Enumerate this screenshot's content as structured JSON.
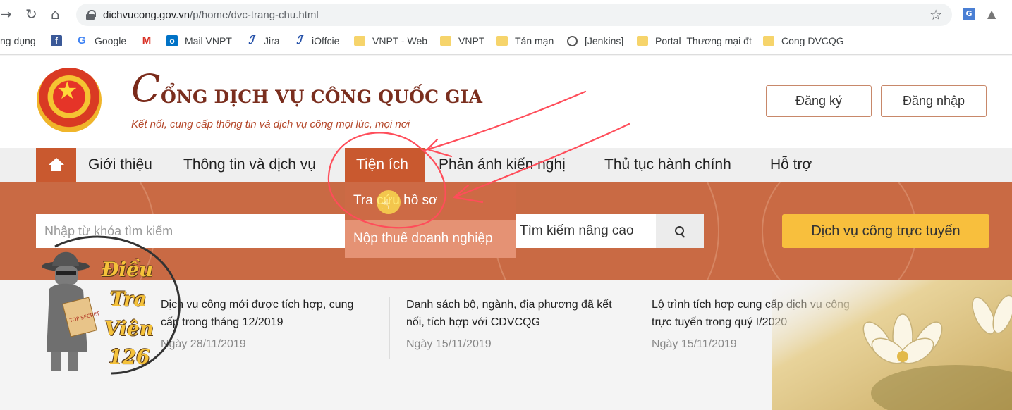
{
  "browser": {
    "url_host": "dichvucong.gov.vn",
    "url_path": "/p/home/dvc-trang-chu.html",
    "bookmarks": [
      {
        "icon": "folder-icon",
        "label": "ng dụng"
      },
      {
        "icon": "facebook-icon",
        "label": ""
      },
      {
        "icon": "google-icon",
        "label": "Google"
      },
      {
        "icon": "gmail-icon",
        "label": ""
      },
      {
        "icon": "outlook-icon",
        "label": "Mail VNPT"
      },
      {
        "icon": "jira-icon",
        "label": "Jira"
      },
      {
        "icon": "ioffice-icon",
        "label": "iOffcie"
      },
      {
        "icon": "folder-icon",
        "label": "VNPT - Web"
      },
      {
        "icon": "folder-icon",
        "label": "VNPT"
      },
      {
        "icon": "folder-icon",
        "label": "Tản mạn"
      },
      {
        "icon": "globe-icon",
        "label": "[Jenkins]"
      },
      {
        "icon": "folder-icon",
        "label": "Portal_Thương mại đt"
      },
      {
        "icon": "folder-icon",
        "label": "Cong DVCQG"
      }
    ]
  },
  "header": {
    "title": "ỔNG DỊCH VỤ CÔNG QUỐC GIA",
    "logo_letter": "C",
    "slogan": "Kết nối, cung cấp thông tin và dịch vụ công mọi lúc, mọi nơi",
    "register_label": "Đăng ký",
    "login_label": "Đăng nhập"
  },
  "nav": {
    "items": [
      "Giới thiệu",
      "Thông tin và dịch vụ",
      "Tiện ích",
      "Phản ánh kiến nghị",
      "Thủ tục hành chính",
      "Hỗ trợ"
    ],
    "active": "Tiện ích"
  },
  "dropdown": {
    "items": [
      "Tra cứu hồ sơ",
      "Nộp thuế doanh nghiệp"
    ]
  },
  "search": {
    "placeholder": "Nhập từ khóa tìm kiếm",
    "advanced_label": "Tìm kiếm nâng cao",
    "online_service_label": "Dịch vụ công trực tuyến"
  },
  "news": [
    {
      "title": "Dịch vụ công mới được tích hợp, cung cấp trong tháng 12/2019",
      "date": "Ngày 28/11/2019"
    },
    {
      "title": "Danh sách bộ, ngành, địa phương đã kết nối, tích hợp với CDVCQG",
      "date": "Ngày 15/11/2019"
    },
    {
      "title": "Lộ trình tích hợp cung cấp dịch vụ công trực tuyến trong quý I/2020",
      "date": "Ngày 15/11/2019"
    }
  ],
  "watermark": {
    "lines": [
      "Điều",
      "Tra",
      "Viên",
      "126"
    ],
    "badge": "TOP SECRET"
  },
  "colors": {
    "brand": "#c9592f",
    "banner": "#c96a44",
    "cta": "#f8bf3d",
    "annotation": "#ff4d5a"
  }
}
